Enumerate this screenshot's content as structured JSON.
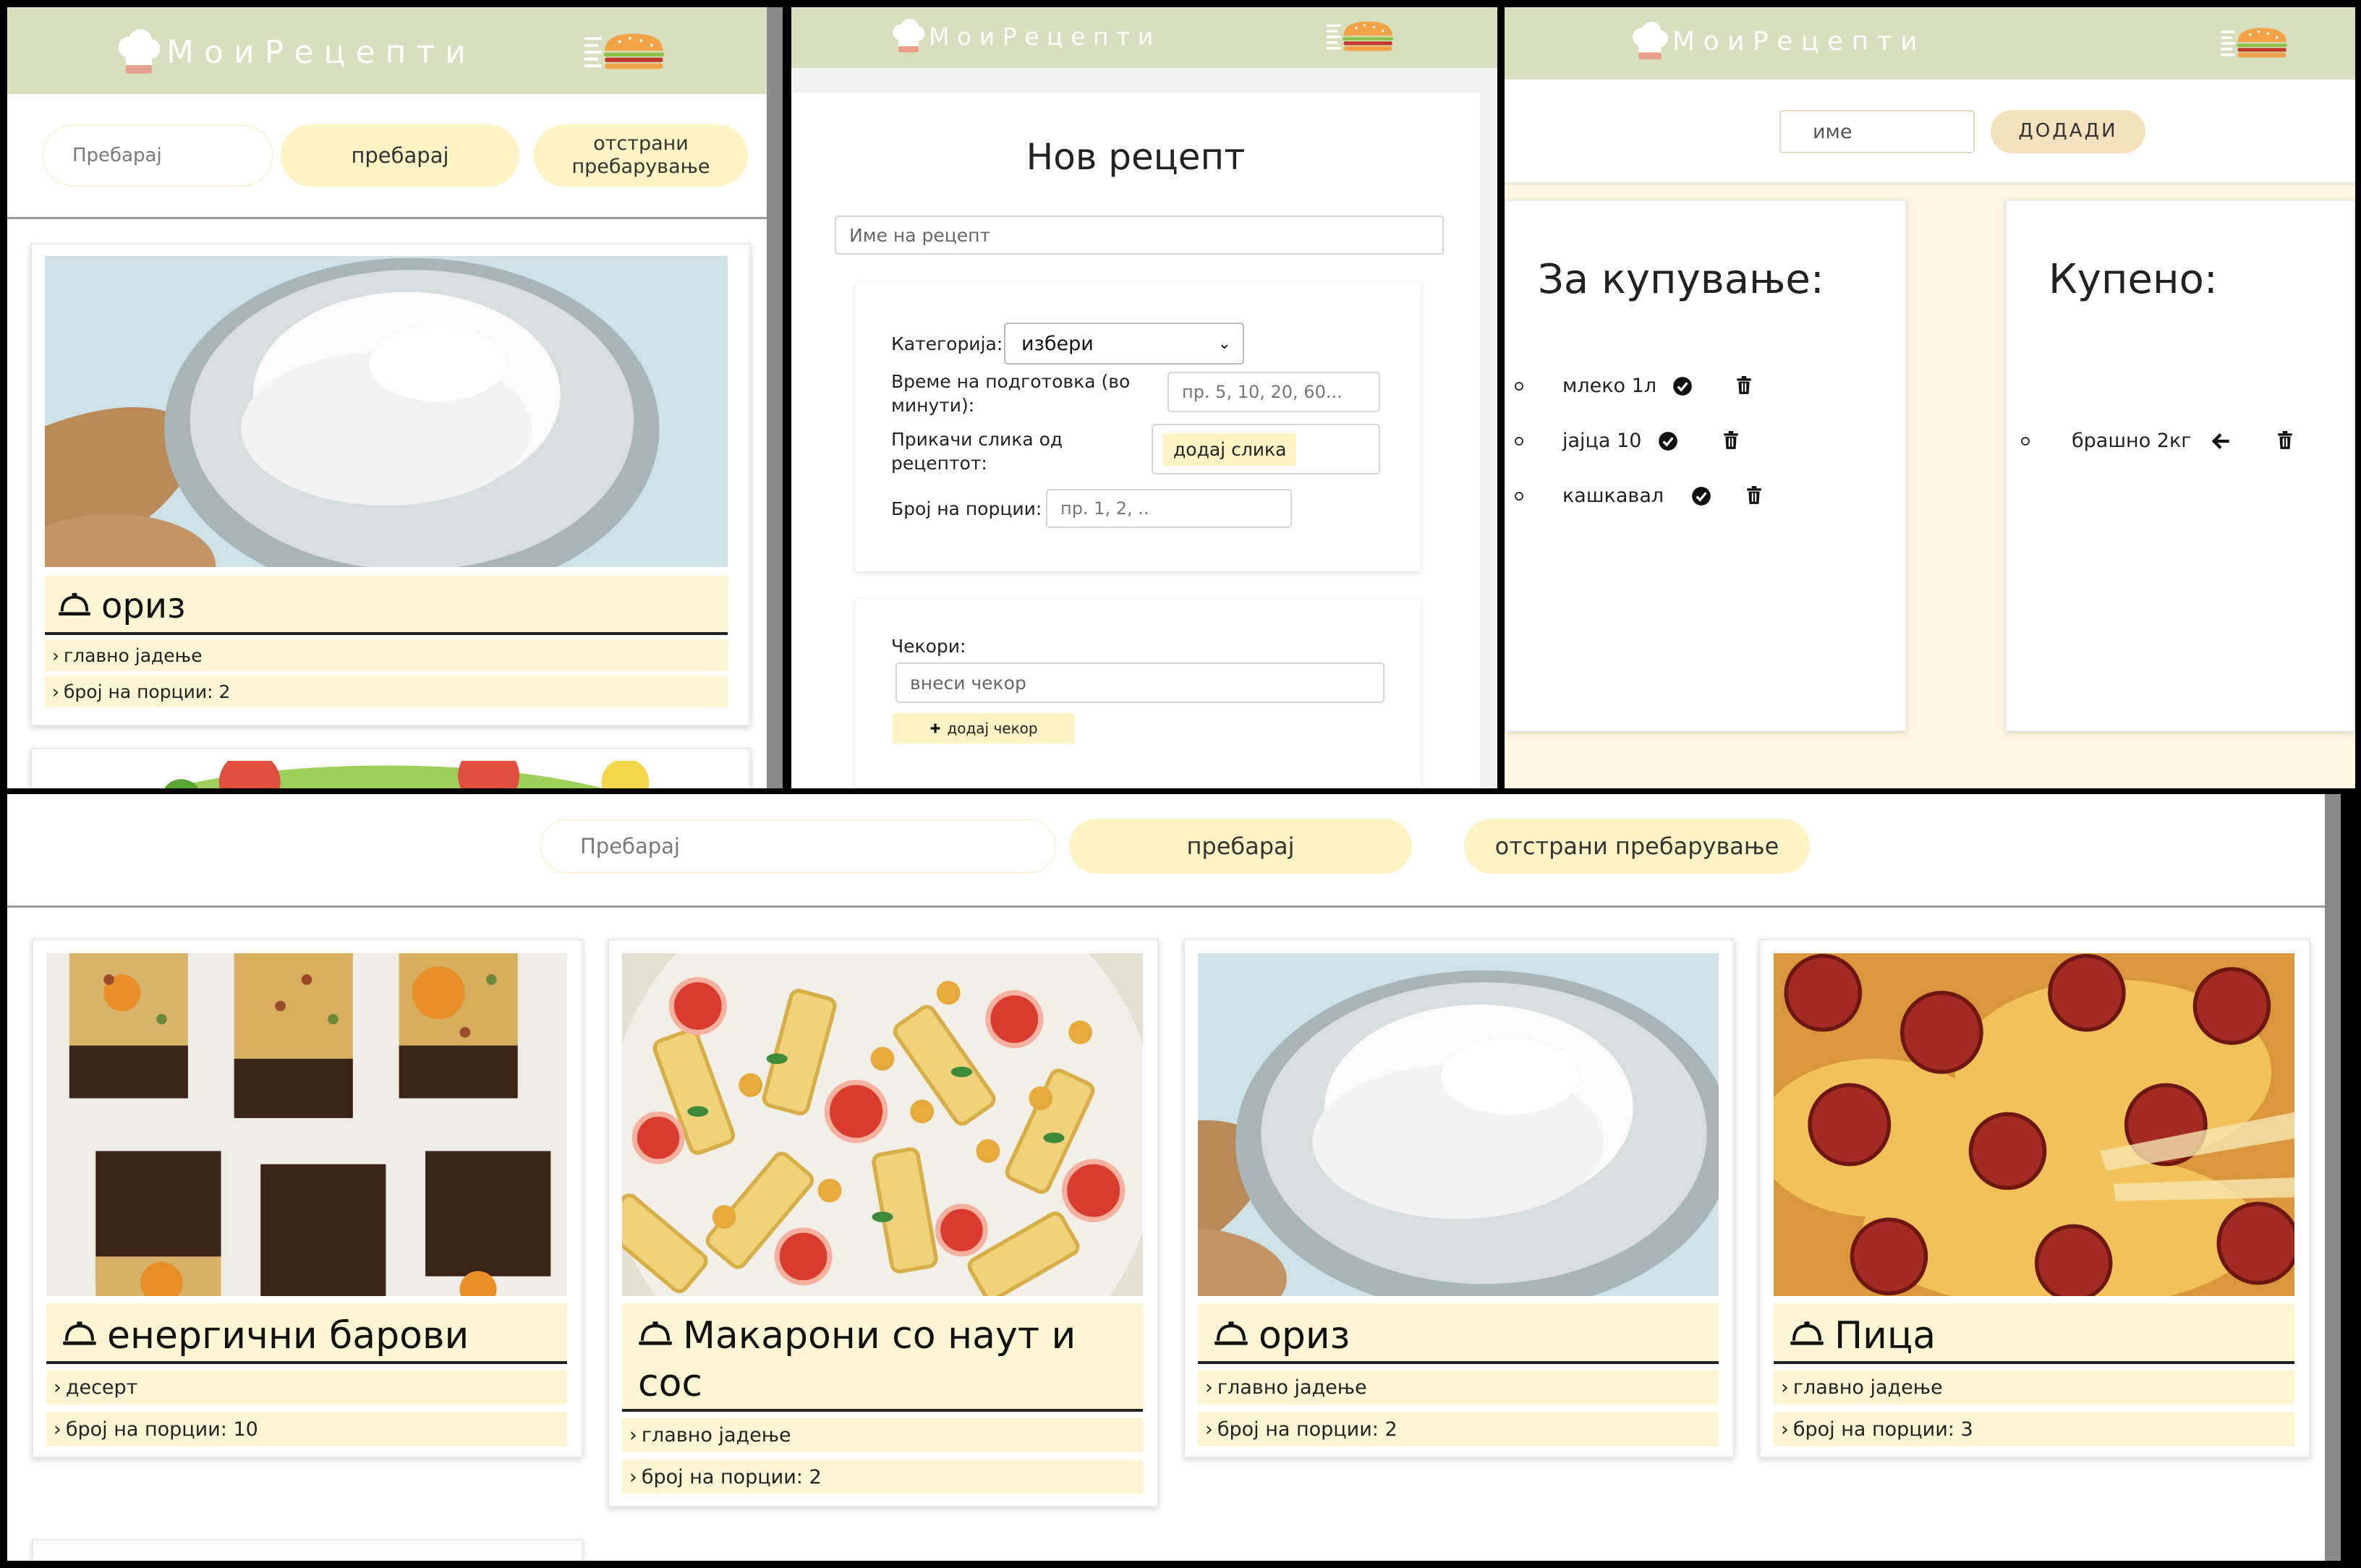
{
  "app": {
    "title": "МоиРецепти"
  },
  "search": {
    "placeholder": "Пребарај",
    "search_button": "пребарај",
    "clear_button_split": [
      "отстрани",
      "пребарување"
    ],
    "clear_button": "отстрани пребарување"
  },
  "mobile_recipe": {
    "name": "ориз",
    "category": "главно јадење",
    "portions": "број на порции: 2"
  },
  "new_recipe": {
    "title": "Нов рецепт",
    "name_placeholder": "Име на рецепт",
    "category_label": "Категорија:",
    "category_selected": "избери",
    "prep_label": "Време на подготовка (во минути):",
    "prep_placeholder": "пр. 5, 10, 20, 60...",
    "image_label": "Прикачи слика од рецептот:",
    "image_button": "додај слика",
    "portions_label": "Број на порции:",
    "portions_placeholder": "пр. 1, 2, ..",
    "steps_label": "Чекори:",
    "step_placeholder": "внеси чекор",
    "add_step_button": "додај чекор"
  },
  "shopping": {
    "name_placeholder": "име",
    "add_button": "ДОДАДИ",
    "to_buy_title": "За купување:",
    "bought_title": "Купено:",
    "to_buy": [
      "млеко 1л",
      "јајца 10",
      "кашкавал"
    ],
    "bought": [
      "брашно 2кг"
    ]
  },
  "recipes": [
    {
      "name": "енергични барови",
      "category": "десерт",
      "portions": "број на порции: 10",
      "photo": "energy-bars"
    },
    {
      "name": "Макарони со наут и сос",
      "category": "главно јадење",
      "portions": "број на порции: 2",
      "photo": "pasta"
    },
    {
      "name": "ориз",
      "category": "главно јадење",
      "portions": "број на порции: 2",
      "photo": "rice"
    },
    {
      "name": "Пица",
      "category": "главно јадење",
      "portions": "број на порции: 3",
      "photo": "pizza"
    }
  ],
  "colors": {
    "header": "#d8dfbf",
    "pill": "#fdf3c4",
    "card_bar": "#fdf5d3"
  },
  "icons": [
    "chef-hat-icon",
    "burger-menu-icon",
    "food-dome-icon",
    "check-circle-icon",
    "trash-icon",
    "arrow-left-icon",
    "plus-icon",
    "chevron-right-icon"
  ]
}
